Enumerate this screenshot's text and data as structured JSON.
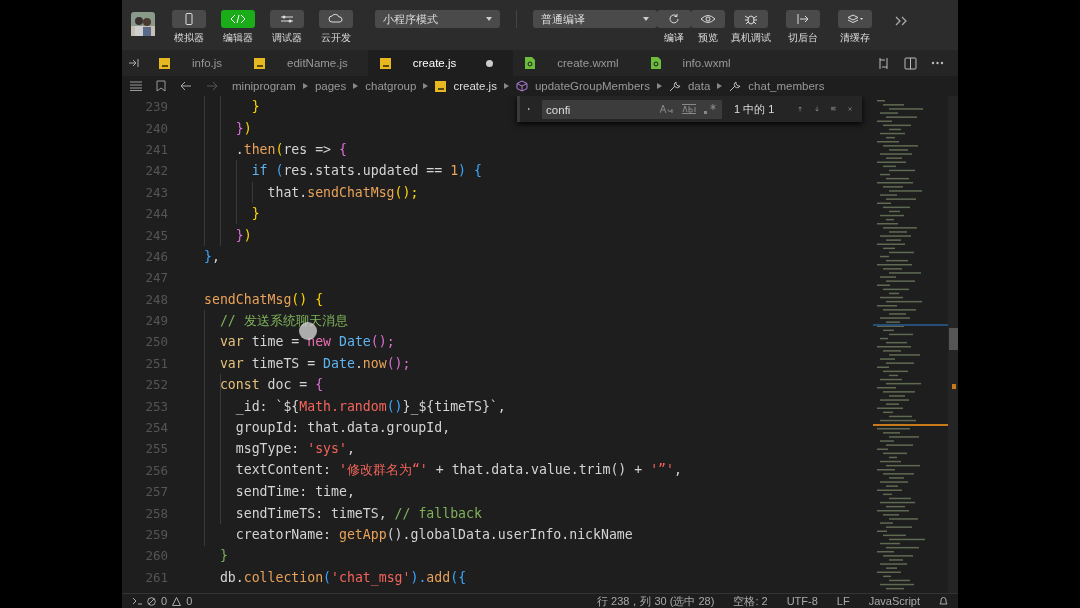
{
  "toolbar": {
    "tools": [
      {
        "label": "模拟器",
        "kind": "phone",
        "selected": false
      },
      {
        "label": "编辑器",
        "kind": "code",
        "selected": true
      },
      {
        "label": "调试器",
        "kind": "sliders",
        "selected": false
      },
      {
        "label": "云开发",
        "kind": "cloud",
        "selected": false
      }
    ],
    "mode_select": {
      "value": "小程序模式"
    },
    "compile_select": {
      "value": "普通编译"
    },
    "actions": [
      {
        "label": "编译",
        "kind": "refresh"
      },
      {
        "label": "预览",
        "kind": "eye"
      },
      {
        "label": "真机调试",
        "kind": "bug"
      },
      {
        "label": "切后台",
        "kind": "switch"
      },
      {
        "label": "清缓存",
        "kind": "layers"
      }
    ]
  },
  "tabs": [
    {
      "label": "info.js",
      "kind": "js",
      "selected": false,
      "modified": false
    },
    {
      "label": "editName.js",
      "kind": "js",
      "selected": false,
      "modified": false
    },
    {
      "label": "create.js",
      "kind": "js",
      "selected": true,
      "modified": true
    },
    {
      "label": "create.wxml",
      "kind": "wxml",
      "selected": false,
      "modified": false
    },
    {
      "label": "info.wxml",
      "kind": "wxml",
      "selected": false,
      "modified": false
    }
  ],
  "breadcrumb": [
    {
      "label": "miniprogram",
      "kind": "folder"
    },
    {
      "label": "pages",
      "kind": "folder"
    },
    {
      "label": "chatgroup",
      "kind": "folder"
    },
    {
      "label": "create.js",
      "kind": "js"
    },
    {
      "label": "updateGroupMembers",
      "kind": "method"
    },
    {
      "label": "data",
      "kind": "property"
    },
    {
      "label": "chat_members",
      "kind": "property"
    }
  ],
  "find": {
    "query": "confi",
    "result": "1 中的 1"
  },
  "editor": {
    "lines": [
      {
        "number": "239",
        "tokens": [
          {
            "text": "      }",
            "kind": "b1"
          }
        ]
      },
      {
        "number": "240",
        "tokens": [
          {
            "text": "    }",
            "kind": "b2"
          },
          {
            "text": ")",
            "kind": "b1"
          }
        ]
      },
      {
        "number": "241",
        "tokens": [
          {
            "text": "    .",
            "kind": "p"
          },
          {
            "text": "then",
            "kind": "fn"
          },
          {
            "text": "(",
            "kind": "b1"
          },
          {
            "text": "res => ",
            "kind": "p"
          },
          {
            "text": "{",
            "kind": "b2"
          }
        ]
      },
      {
        "number": "242",
        "tokens": [
          {
            "text": "      if",
            "kind": "ctl"
          },
          {
            "text": " (",
            "kind": "b3"
          },
          {
            "text": "res.stats.updated == ",
            "kind": "p"
          },
          {
            "text": "1",
            "kind": "num"
          },
          {
            "text": ") {",
            "kind": "b3"
          }
        ]
      },
      {
        "number": "243",
        "tokens": [
          {
            "text": "        that.",
            "kind": "p"
          },
          {
            "text": "sendChatMsg",
            "kind": "fn"
          },
          {
            "text": "();",
            "kind": "b1"
          }
        ]
      },
      {
        "number": "244",
        "tokens": [
          {
            "text": "      }",
            "kind": "b1"
          }
        ]
      },
      {
        "number": "245",
        "tokens": [
          {
            "text": "    }",
            "kind": "b2"
          },
          {
            "text": ")",
            "kind": "b1"
          }
        ]
      },
      {
        "number": "246",
        "tokens": [
          {
            "text": "}",
            "kind": "b3"
          },
          {
            "text": ",",
            "kind": "p"
          }
        ]
      },
      {
        "number": "247"
      },
      {
        "number": "248",
        "tokens": [
          {
            "text": "sendChatMsg",
            "kind": "fn"
          },
          {
            "text": "() {",
            "kind": "b1"
          }
        ]
      },
      {
        "number": "249",
        "tokens": [
          {
            "text": "  // 发送系统聊天消息",
            "kind": "cm"
          }
        ]
      },
      {
        "number": "250",
        "tokens": [
          {
            "text": "  var",
            "kind": "kw"
          },
          {
            "text": " time = ",
            "kind": "p"
          },
          {
            "text": "new",
            "kind": "new"
          },
          {
            "text": " Date",
            "kind": "cls"
          },
          {
            "text": "();",
            "kind": "b2"
          }
        ]
      },
      {
        "number": "251",
        "tokens": [
          {
            "text": "  var",
            "kind": "kw"
          },
          {
            "text": " timeTS = ",
            "kind": "p"
          },
          {
            "text": "Date",
            "kind": "cls"
          },
          {
            "text": ".",
            "kind": "p"
          },
          {
            "text": "now",
            "kind": "fn"
          },
          {
            "text": "();",
            "kind": "b2"
          }
        ]
      },
      {
        "number": "252",
        "tokens": [
          {
            "text": "  const",
            "kind": "kw"
          },
          {
            "text": " doc = ",
            "kind": "p"
          },
          {
            "text": "{",
            "kind": "b2"
          }
        ]
      },
      {
        "number": "253",
        "tokens": [
          {
            "text": "    _id: `${",
            "kind": "p"
          },
          {
            "text": "Math.random",
            "kind": "str"
          },
          {
            "text": "()",
            "kind": "b3"
          },
          {
            "text": "}_${timeTS}`,",
            "kind": "p"
          }
        ]
      },
      {
        "number": "254",
        "tokens": [
          {
            "text": "    groupId: that.data.groupId,",
            "kind": "p"
          }
        ]
      },
      {
        "number": "255",
        "tokens": [
          {
            "text": "    msgType: ",
            "kind": "p"
          },
          {
            "text": "'sys'",
            "kind": "str"
          },
          {
            "text": ",",
            "kind": "p"
          }
        ]
      },
      {
        "number": "256",
        "tokens": [
          {
            "text": "    textContent: ",
            "kind": "p"
          },
          {
            "text": "'修改群名为“'",
            "kind": "str"
          },
          {
            "text": " + that.data.value.trim() + ",
            "kind": "p"
          },
          {
            "text": "'”'",
            "kind": "str"
          },
          {
            "text": ",",
            "kind": "p"
          }
        ]
      },
      {
        "number": "257",
        "tokens": [
          {
            "text": "    sendTime: time,",
            "kind": "p"
          }
        ]
      },
      {
        "number": "258",
        "tokens": [
          {
            "text": "    sendTimeTS: timeTS, ",
            "kind": "p"
          },
          {
            "text": "// fallback",
            "kind": "cm"
          }
        ]
      },
      {
        "number": "259",
        "tokens": [
          {
            "text": "    creatorName: ",
            "kind": "p"
          },
          {
            "text": "getApp",
            "kind": "fn"
          },
          {
            "text": "().globalData.userInfo.nickName",
            "kind": "p"
          }
        ]
      },
      {
        "number": "260",
        "tokens": [
          {
            "text": "  }",
            "kind": "cm"
          }
        ]
      },
      {
        "number": "261",
        "tokens": [
          {
            "text": "  db.",
            "kind": "p"
          },
          {
            "text": "collection",
            "kind": "fn"
          },
          {
            "text": "(",
            "kind": "b3"
          },
          {
            "text": "'chat_msg'",
            "kind": "str"
          },
          {
            "text": ").",
            "kind": "b3"
          },
          {
            "text": "add",
            "kind": "fn"
          },
          {
            "text": "({",
            "kind": "b3"
          }
        ]
      }
    ]
  },
  "status_bar": {
    "errors": "0",
    "warnings": "0",
    "items": [
      "行 238，列 30 (选中 28)",
      "空格: 2",
      "UTF-8",
      "LF",
      "JavaScript"
    ]
  }
}
